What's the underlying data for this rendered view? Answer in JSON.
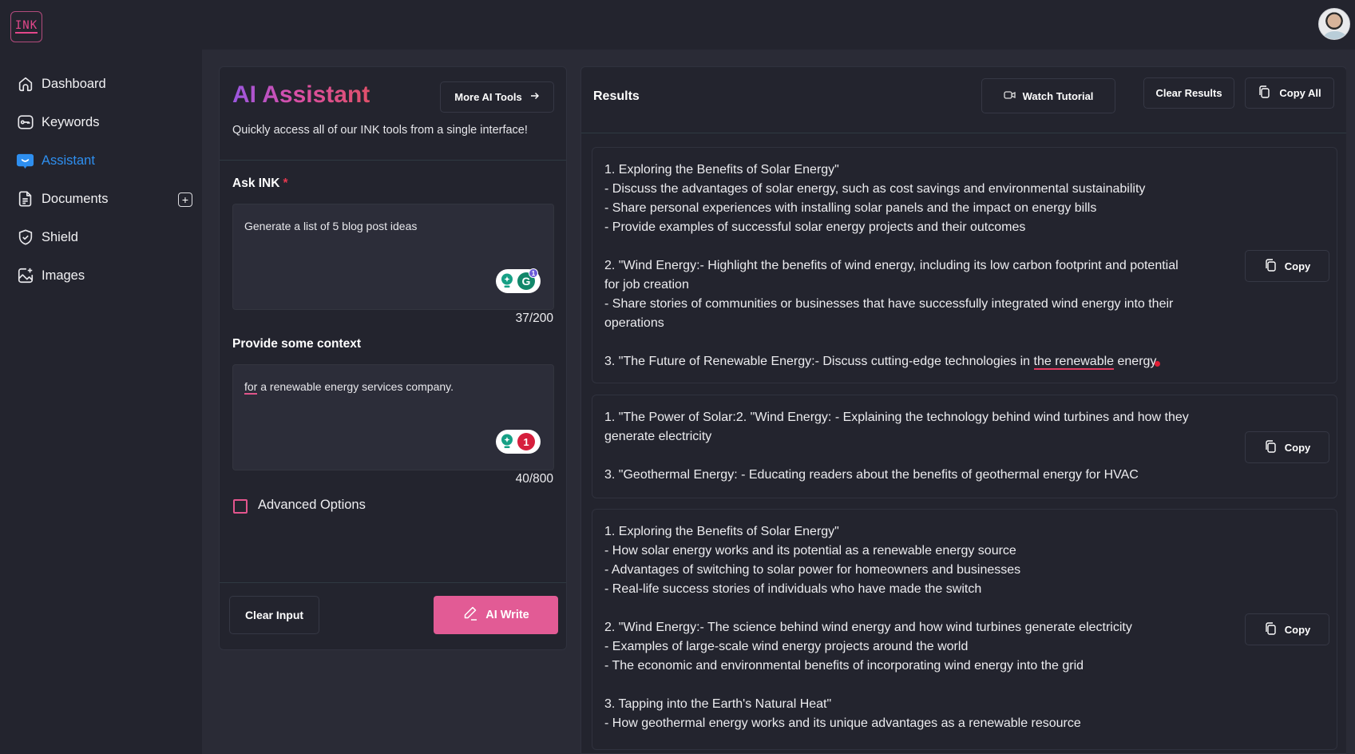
{
  "app": {
    "logo_text": "INK"
  },
  "sidebar": {
    "items": [
      {
        "label": "Dashboard",
        "icon": "home-icon",
        "active": false
      },
      {
        "label": "Keywords",
        "icon": "key-icon",
        "active": false
      },
      {
        "label": "Assistant",
        "icon": "chat-bubble-icon",
        "active": true
      },
      {
        "label": "Documents",
        "icon": "document-icon",
        "active": false,
        "add_button": "+"
      },
      {
        "label": "Shield",
        "icon": "shield-check-icon",
        "active": false
      },
      {
        "label": "Images",
        "icon": "image-add-icon",
        "active": false
      }
    ]
  },
  "assistant": {
    "title": "AI Assistant",
    "more_tools_label": "More AI Tools",
    "subtitle": "Quickly access all of our INK tools from a single interface!",
    "ask_label": "Ask INK",
    "ask_required_mark": "*",
    "ask_value": "Generate a list of 5 blog post ideas",
    "ask_counter": "37/200",
    "ask_grammarly_count": "1",
    "context_label": "Provide some context",
    "context_value_first_word": "for",
    "context_value_rest": " a renewable energy services company.",
    "context_counter": "40/800",
    "context_issue_count": "1",
    "advanced_options_label": "Advanced Options",
    "advanced_options_checked": false,
    "clear_input_label": "Clear Input",
    "ai_write_label": "AI Write"
  },
  "results": {
    "title": "Results",
    "watch_tutorial_label": "Watch Tutorial",
    "clear_results_label": "Clear Results",
    "copy_all_label": "Copy All",
    "copy_label": "Copy",
    "cards": [
      {
        "lines": [
          "1. Exploring the Benefits of Solar Energy\"",
          "- Discuss the advantages of solar energy, such as cost savings and environmental sustainability",
          "- Share personal experiences with installing solar panels and the impact on energy bills",
          "- Provide examples of successful solar energy projects and their outcomes",
          "",
          "2. \"Wind Energy:- Highlight the benefits of wind energy, including its low carbon footprint and potential for job creation",
          "- Share stories of communities or businesses that have successfully integrated wind energy into their operations",
          ""
        ],
        "last_line_prefix": "3. \"The Future of Renewable Energy:- Discuss cutting-edge technologies in ",
        "last_line_flagged": "the renewable",
        "last_line_suffix": " energy"
      },
      {
        "lines": [
          "1. \"The Power of Solar:2. \"Wind Energy:   - Explaining the technology behind wind turbines and how they generate electricity",
          "",
          "3. \"Geothermal Energy:   - Educating readers about the benefits of geothermal energy for HVAC"
        ]
      },
      {
        "lines": [
          "1. Exploring the Benefits of Solar Energy\"",
          "- How solar energy works and its potential as a renewable energy source",
          "- Advantages of switching to solar power for homeowners and businesses",
          "- Real-life success stories of individuals who have made the switch",
          "",
          "2. \"Wind Energy:- The science behind wind energy and how wind turbines generate electricity",
          "- Examples of large-scale wind energy projects around the world",
          "- The economic and environmental benefits of incorporating wind energy into the grid",
          "",
          "3. Tapping into the Earth's Natural Heat\"",
          "- How geothermal energy works and its unique advantages as a renewable resource"
        ]
      }
    ]
  },
  "colors": {
    "accent_pink": "#e25b95",
    "active_blue": "#2e8ff0",
    "background": "#23242e"
  }
}
